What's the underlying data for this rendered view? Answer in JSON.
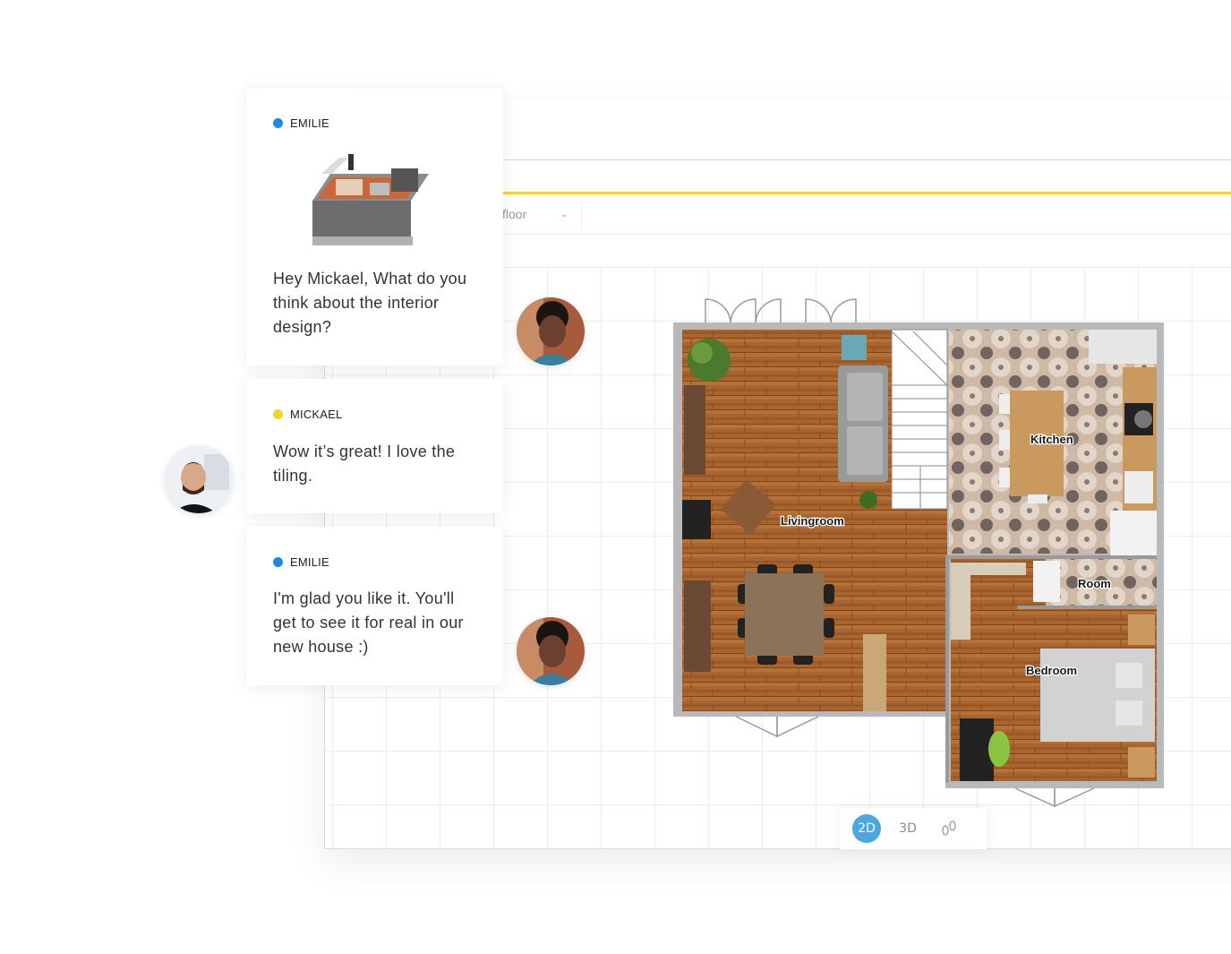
{
  "editor": {
    "floor_selector": "floor",
    "view_modes": [
      {
        "label": "2D",
        "active": true
      },
      {
        "label": "3D",
        "active": false
      }
    ],
    "walk_icon": "footsteps-icon"
  },
  "plan": {
    "rooms": [
      "Livingroom",
      "Kitchen",
      "Room",
      "Bedroom"
    ]
  },
  "chat": [
    {
      "author": "EMILIE",
      "color": "#1e88e5",
      "text": "Hey Mickael, What do you think about the interior design?",
      "has_image": true
    },
    {
      "author": "MICKAEL",
      "color": "#f7d51d",
      "text": "Wow it’s great! I love the tiling."
    },
    {
      "author": "EMILIE",
      "color": "#1e88e5",
      "text": "I'm glad you like it. You'll get to see it for real in our new house :)"
    }
  ],
  "colors": {
    "accent_yellow": "#f6d13b",
    "active_blue": "#4ba7dd"
  }
}
